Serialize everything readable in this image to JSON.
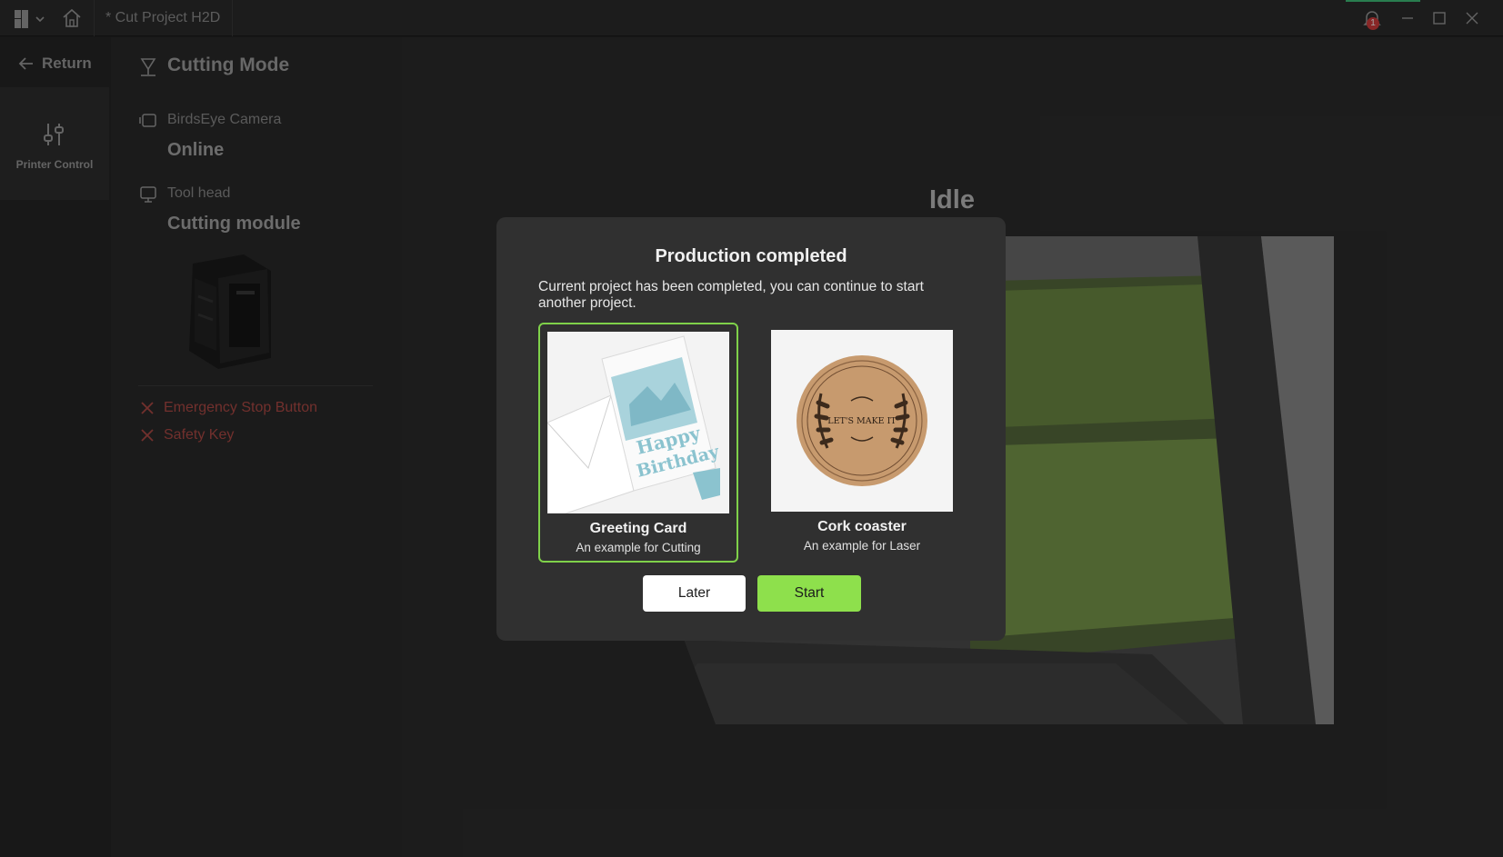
{
  "titlebar": {
    "project_tab": "* Cut Project H2D",
    "notification_count": "1",
    "icons": [
      "app-menu-icon",
      "home-icon",
      "bell-icon",
      "minimize-icon",
      "maximize-icon",
      "close-icon"
    ]
  },
  "nav": {
    "return_label": "Return",
    "item_label": "Printer Control"
  },
  "panel": {
    "mode_title": "Cutting Mode",
    "camera_label": "BirdsEye Camera",
    "camera_status": "Online",
    "toolhead_label": "Tool head",
    "toolhead_value": "Cutting module",
    "warnings": [
      "Emergency Stop Button",
      "Safety Key"
    ]
  },
  "main": {
    "status": "Idle"
  },
  "dialog": {
    "title": "Production completed",
    "message": "Current project has been completed, you can continue to start another project.",
    "cards": [
      {
        "name": "Greeting Card",
        "subtitle": "An example for Cutting",
        "selected": true,
        "image_text": [
          "Happy",
          "Birthday"
        ]
      },
      {
        "name": "Cork coaster",
        "subtitle": "An example for Laser",
        "selected": false,
        "image_text": [
          "LET'S MAKE IT"
        ]
      }
    ],
    "later_label": "Later",
    "start_label": "Start"
  },
  "colors": {
    "accent_green": "#8ee04c",
    "warning_red": "#b04a46",
    "badge_red": "#d23c3c"
  }
}
